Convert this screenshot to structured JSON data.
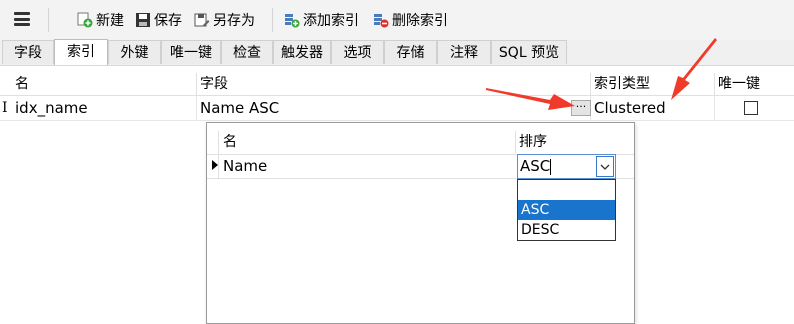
{
  "toolbar": {
    "new_label": "新建",
    "save_label": "保存",
    "save_as_label": "另存为",
    "add_index_label": "添加索引",
    "delete_index_label": "删除索引"
  },
  "tabs": [
    {
      "label": "字段"
    },
    {
      "label": "索引",
      "active": true
    },
    {
      "label": "外键"
    },
    {
      "label": "唯一键"
    },
    {
      "label": "检查"
    },
    {
      "label": "触发器"
    },
    {
      "label": "选项"
    },
    {
      "label": "存储"
    },
    {
      "label": "注释"
    },
    {
      "label": "SQL 预览"
    }
  ],
  "index_grid": {
    "columns": [
      "名",
      "字段",
      "索引类型",
      "唯一键"
    ],
    "rows": [
      {
        "name": "idx_name",
        "fields": "Name ASC",
        "ellipsis": "···",
        "index_type": "Clustered",
        "unique": false
      }
    ]
  },
  "field_popup": {
    "columns": [
      "名",
      "排序"
    ],
    "rows": [
      {
        "name": "Name",
        "sort": "ASC"
      }
    ],
    "sort_options": [
      "",
      "ASC",
      "DESC"
    ],
    "selected_option": "ASC"
  },
  "colors": {
    "arrow": "#f03a2a",
    "selection": "#1874cd",
    "focus_border": "#5b8fd0"
  }
}
